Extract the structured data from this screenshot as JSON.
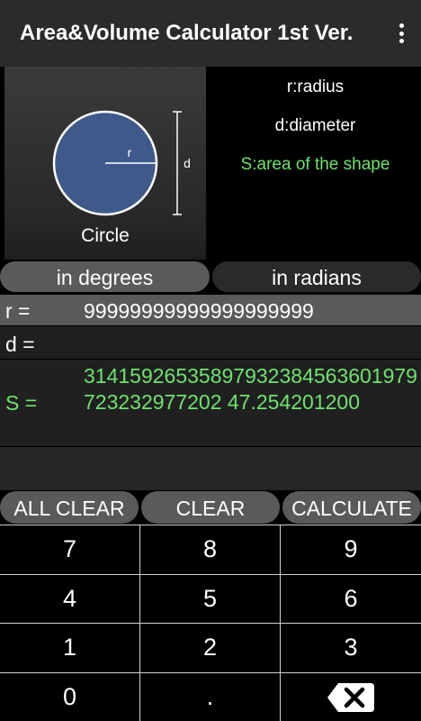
{
  "app_bar": {
    "title": "Area&Volume Calculator 1st Ver.",
    "menu_icon": "more-vert-icon"
  },
  "figure": {
    "shape_name": "Circle",
    "radius_symbol": "r",
    "diameter_symbol": "d",
    "circle_color": "#3f5a8a"
  },
  "legend": {
    "radius": "r:radius",
    "diameter": "d:diameter",
    "area": "S:area of the shape"
  },
  "unit_toggle": {
    "degrees": "in degrees",
    "radians": "in radians"
  },
  "inputs": {
    "r_label": "r =",
    "r_value": "99999999999999999999",
    "d_label": "d =",
    "d_value": "",
    "s_label": "S =",
    "s_value": "31415926535897932384563601979723232977202 47.254201200"
  },
  "actions": {
    "all_clear": "ALL CLEAR",
    "clear": "CLEAR",
    "calculate": "CALCULATE"
  },
  "keypad": [
    "7",
    "8",
    "9",
    "4",
    "5",
    "6",
    "1",
    "2",
    "3",
    "0",
    ".",
    "backspace"
  ],
  "colors": {
    "accent_green": "#6ee36e",
    "button_gray": "#5a5a5a"
  }
}
